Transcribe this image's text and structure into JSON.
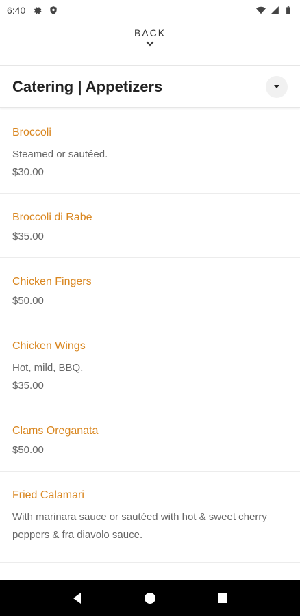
{
  "status_bar": {
    "time": "6:40",
    "icons_left": [
      "gear-icon",
      "shield-icon"
    ],
    "icons_right": [
      "wifi-icon",
      "signal-icon",
      "battery-icon"
    ]
  },
  "back": {
    "label": "BACK"
  },
  "header": {
    "title": "Catering | Appetizers"
  },
  "menu_items": [
    {
      "name": "Broccoli",
      "description": "Steamed or sautéed.",
      "price": "$30.00"
    },
    {
      "name": "Broccoli di Rabe",
      "description": "",
      "price": "$35.00"
    },
    {
      "name": "Chicken Fingers",
      "description": "",
      "price": "$50.00"
    },
    {
      "name": "Chicken Wings",
      "description": "Hot, mild, BBQ.",
      "price": "$35.00"
    },
    {
      "name": "Clams Oreganata",
      "description": "",
      "price": "$50.00"
    },
    {
      "name": "Fried Calamari",
      "description": "With marinara sauce or sautéed with hot & sweet cherry peppers & fra diavolo sauce.",
      "price": ""
    }
  ],
  "colors": {
    "accent": "#d9861f",
    "text_muted": "#666666",
    "nav_bar": "#000000"
  }
}
